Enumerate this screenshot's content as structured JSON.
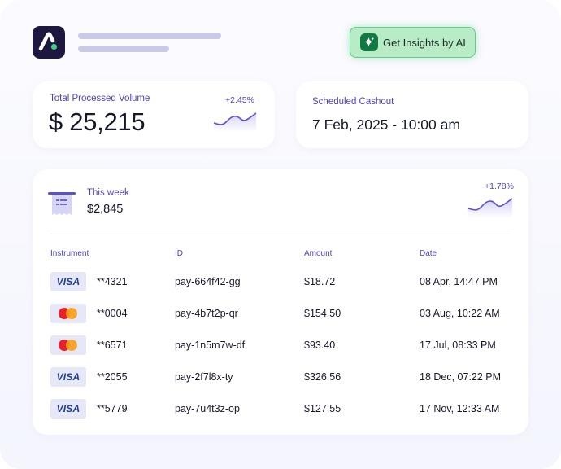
{
  "header": {
    "insights_button_label": "Get Insights by AI"
  },
  "volume": {
    "label": "Total Processed Volume",
    "value": "$ 25,215",
    "change": "+2.45%"
  },
  "cashout": {
    "label": "Scheduled Cashout",
    "value": "7 Feb, 2025 - 10:00 am"
  },
  "week": {
    "label": "This week",
    "value": "$2,845",
    "change": "+1.78%"
  },
  "table": {
    "columns": [
      "Instrument",
      "ID",
      "Amount",
      "Date"
    ],
    "rows": [
      {
        "brand": "VISA",
        "card": "**4321",
        "id": "pay-664f42-gg",
        "amount": "$18.72",
        "date": "08 Apr, 14:47 PM"
      },
      {
        "brand": "mastercard",
        "card": "**0004",
        "id": "pay-4b7t2p-qr",
        "amount": "$154.50",
        "date": "03 Aug, 10:22 AM"
      },
      {
        "brand": "mastercard",
        "card": "**6571",
        "id": "pay-1n5m7w-df",
        "amount": "$93.40",
        "date": "17 Jul, 08:33 PM"
      },
      {
        "brand": "VISA",
        "card": "**2055",
        "id": "pay-2f7l8x-ty",
        "amount": "$326.56",
        "date": "18 Dec, 07:22 PM"
      },
      {
        "brand": "VISA",
        "card": "**5779",
        "id": "pay-7u4t3z-op",
        "amount": "$127.55",
        "date": "17 Nov, 12:33 AM"
      }
    ]
  },
  "colors": {
    "accent": "#4b43b8",
    "logo_bg": "#1e1840",
    "ai_button_bg": "#b7ecc6",
    "ai_button_border": "#5fcd85"
  },
  "icons": [
    "app-logo-icon",
    "sparkle-icon",
    "receipt-icon",
    "visa-icon",
    "mastercard-icon",
    "sparkline-chart-icon"
  ]
}
